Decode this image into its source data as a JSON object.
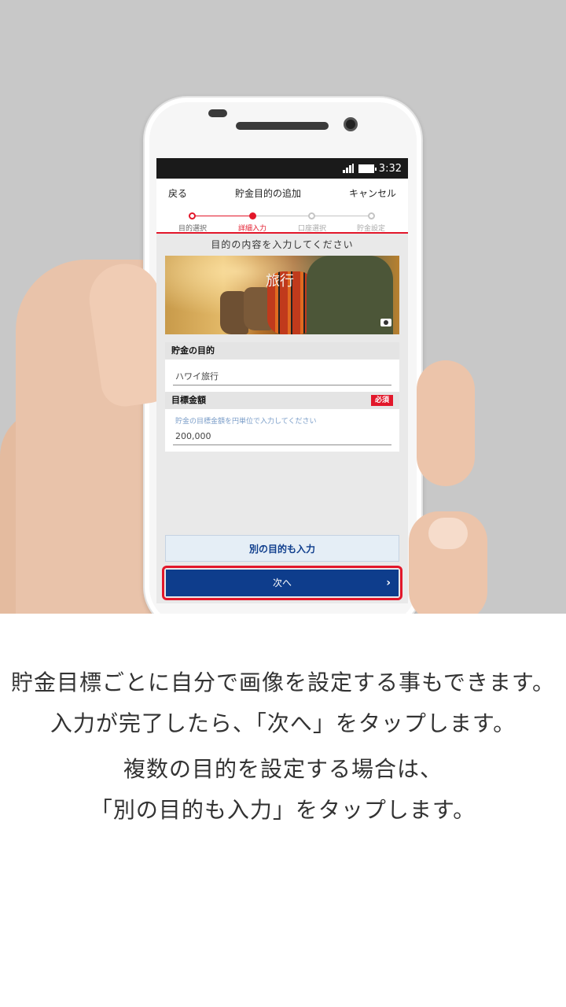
{
  "status_bar": {
    "time": "3:32"
  },
  "nav": {
    "back": "戻る",
    "title": "貯金目的の追加",
    "cancel": "キャンセル"
  },
  "steps": [
    {
      "label": "目的選択"
    },
    {
      "label": "詳細入力"
    },
    {
      "label": "口座選択"
    },
    {
      "label": "貯金設定"
    }
  ],
  "instruction": "目的の内容を入力してください",
  "photo": {
    "label": "旅行"
  },
  "purpose": {
    "header": "貯金の目的",
    "value": "ハワイ旅行"
  },
  "amount": {
    "header": "目標金額",
    "required": "必須",
    "hint": "貯金の目標金額を円単位で入力してください",
    "value": "200,000"
  },
  "buttons": {
    "add_another": "別の目的も入力",
    "next": "次へ",
    "next_chevron": "›"
  },
  "caption": {
    "line1": "貯金目標ごとに自分で画像を設定する事もできます。",
    "line2": "入力が完了したら、「次へ」をタップします。",
    "line3": "複数の目的を設定する場合は、",
    "line4": "「別の目的も入力」をタップします。"
  },
  "colors": {
    "accent_red": "#e2172a",
    "primary_blue": "#0e3d8c"
  }
}
